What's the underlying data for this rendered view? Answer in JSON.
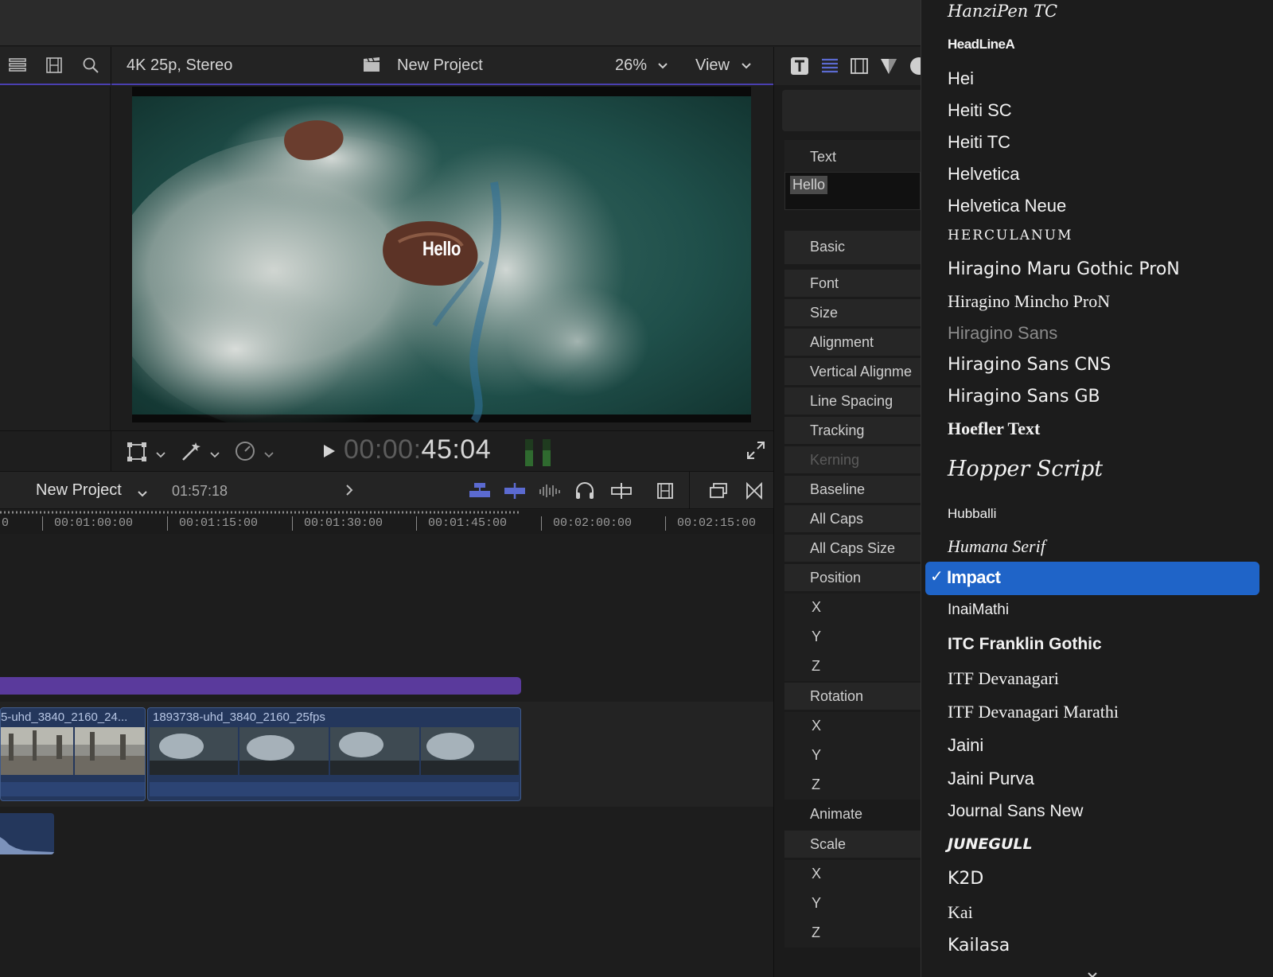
{
  "viewer_header": {
    "format": "4K 25p, Stereo",
    "project_name": "New Project",
    "zoom": "26%",
    "view_label": "View"
  },
  "viewer": {
    "title_text": "Hello"
  },
  "transport": {
    "timecode_dim": "00:00:",
    "timecode_lit": "45:04"
  },
  "timeline_header": {
    "project_name": "New Project",
    "duration": "01:57:18"
  },
  "ruler": {
    "ticks": [
      "00:01:00:00",
      "00:01:15:00",
      "00:01:30:00",
      "00:01:45:00",
      "00:02:00:00",
      "00:02:15:00"
    ],
    "leading": "0"
  },
  "clips": [
    {
      "label": "5-uhd_3840_2160_24..."
    },
    {
      "label": "1893738-uhd_3840_2160_25fps"
    }
  ],
  "inspector": {
    "text_heading": "Text",
    "text_value": "Hello",
    "basic_heading": "Basic",
    "rows": [
      "Font",
      "Size",
      "Alignment",
      "Vertical Alignme",
      "Line Spacing",
      "Tracking",
      "Kerning",
      "Baseline",
      "All Caps",
      "All Caps Size",
      "Position"
    ],
    "position_axes": [
      "X",
      "Y",
      "Z"
    ],
    "rotation_heading": "Rotation",
    "rotation_axes": [
      "X",
      "Y",
      "Z"
    ],
    "animate_label": "Animate",
    "scale_heading": "Scale",
    "scale_axes": [
      "X",
      "Y",
      "Z"
    ]
  },
  "font_menu": {
    "items": [
      "HanziPen TC",
      "HeadLineA",
      "Hei",
      "Heiti SC",
      "Heiti TC",
      "Helvetica",
      "Helvetica Neue",
      "Herculanum",
      "Hiragino Maru Gothic ProN",
      "Hiragino Mincho ProN",
      "Hiragino Sans",
      "Hiragino Sans CNS",
      "Hiragino Sans GB",
      "Hoefler Text",
      "Hopper Script",
      "Hubballi",
      "Humana Serif",
      "Impact",
      "InaiMathi",
      "ITC Franklin Gothic",
      "ITF Devanagari",
      "ITF Devanagari Marathi",
      "Jaini",
      "Jaini Purva",
      "Journal Sans New",
      "JUNEGULL",
      "K2D",
      "Kai",
      "Kailasa"
    ],
    "selected": "Impact",
    "checkmark": "✓"
  },
  "colors": {
    "accent": "#4a3fb0",
    "selection": "#1f64c8",
    "title_clip": "#5a3a9c",
    "video_clip": "#24375c"
  }
}
